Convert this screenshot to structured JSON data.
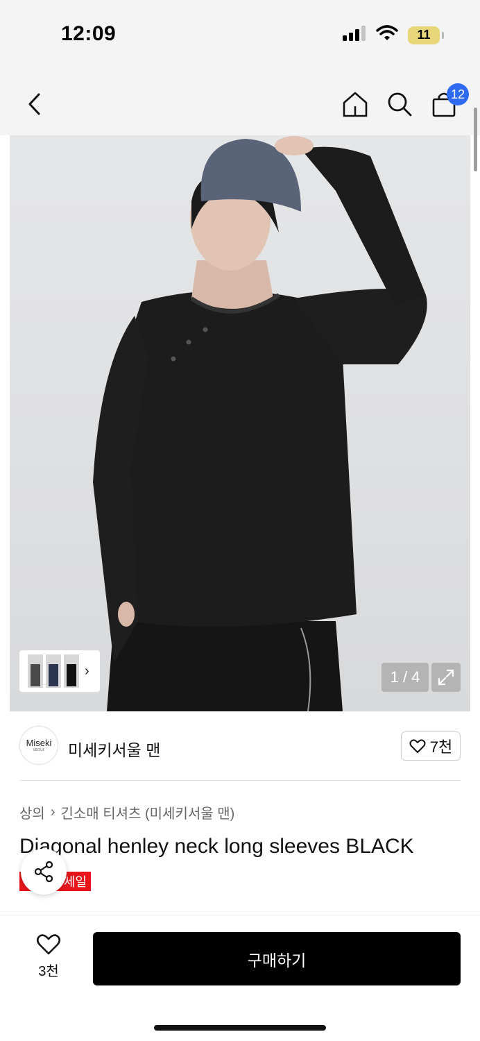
{
  "status_bar": {
    "time": "12:09",
    "battery": "11"
  },
  "header": {
    "cart_count": "12"
  },
  "gallery": {
    "counter": "1 / 4"
  },
  "brand": {
    "logo_text": "Miseki",
    "logo_sub": "SEOUL",
    "name": "미세키서울 맨",
    "like_count": "7천"
  },
  "breadcrumb": {
    "category": "상의",
    "subcategory": "긴소매 티셔츠 (미세키서울 맨)"
  },
  "product": {
    "title": "Diagonal henley neck long sleeves BLACK",
    "sale_label": "세일"
  },
  "bottom": {
    "wish_count": "3천",
    "buy_label": "구매하기"
  },
  "colors": {
    "cart_badge": "#2f6bf2",
    "sale": "#e8161b",
    "buy_button": "#000000"
  }
}
